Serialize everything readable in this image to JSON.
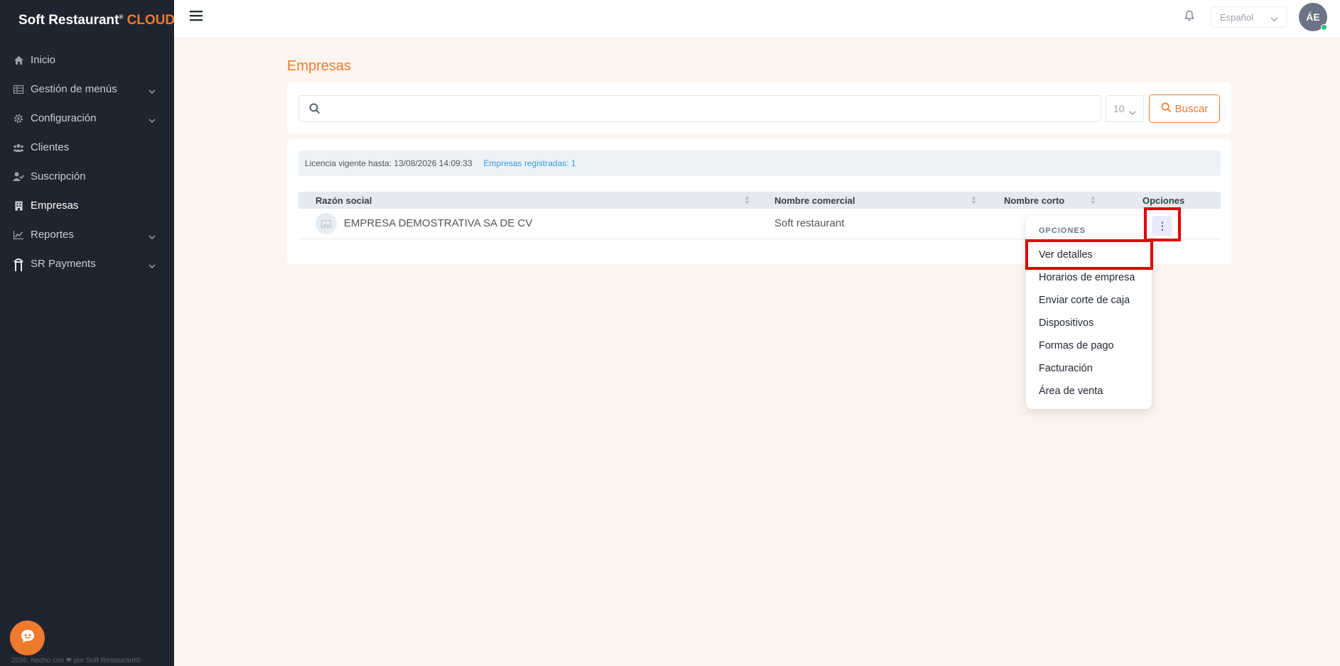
{
  "brand": {
    "name": "Soft Restaurant",
    "reg_mark": "®",
    "suffix": "CLOUD"
  },
  "colors": {
    "accent": "#f07a2c",
    "sidebar_bg": "#1f2530",
    "link_blue": "#2f9de0",
    "highlight_red": "#e30000"
  },
  "sidebar": {
    "items": [
      {
        "label": "Inicio",
        "icon": "home-icon",
        "expandable": false
      },
      {
        "label": "Gestión de menús",
        "icon": "table-icon",
        "expandable": true
      },
      {
        "label": "Configuración",
        "icon": "gear-icon",
        "expandable": true
      },
      {
        "label": "Clientes",
        "icon": "users-icon",
        "expandable": false
      },
      {
        "label": "Suscripción",
        "icon": "user-check-icon",
        "expandable": false
      },
      {
        "label": "Empresas",
        "icon": "building-icon",
        "expandable": false,
        "active": true
      },
      {
        "label": "Reportes",
        "icon": "chart-icon",
        "expandable": true
      },
      {
        "label": "SR Payments",
        "icon": "sr-payments-icon",
        "expandable": true
      }
    ],
    "footer": "2026, hecho con ❤ por Soft Restaurant®"
  },
  "topbar": {
    "language": "Español",
    "avatar_initials": "ÁE"
  },
  "main": {
    "title": "Empresas",
    "search": {
      "placeholder": "",
      "value": "",
      "page_size": "10",
      "button_label": "Buscar"
    },
    "info": {
      "license": "Licencia vigente hasta: 13/08/2026 14:09:33",
      "registered": "Empresas registradas: 1"
    },
    "table": {
      "columns": [
        "Razón social",
        "Nombre comercial",
        "Nombre corto",
        "Opciones"
      ],
      "rows": [
        {
          "razon_social": "EMPRESA DEMOSTRATIVA SA DE CV",
          "nombre_comercial": "Soft restaurant",
          "nombre_corto": ""
        }
      ]
    },
    "dropdown": {
      "header": "OPCIONES",
      "items": [
        "Ver detalles",
        "Horarios de empresa",
        "Enviar corte de caja",
        "Dispositivos",
        "Formas de pago",
        "Facturación",
        "Área de venta"
      ]
    }
  }
}
